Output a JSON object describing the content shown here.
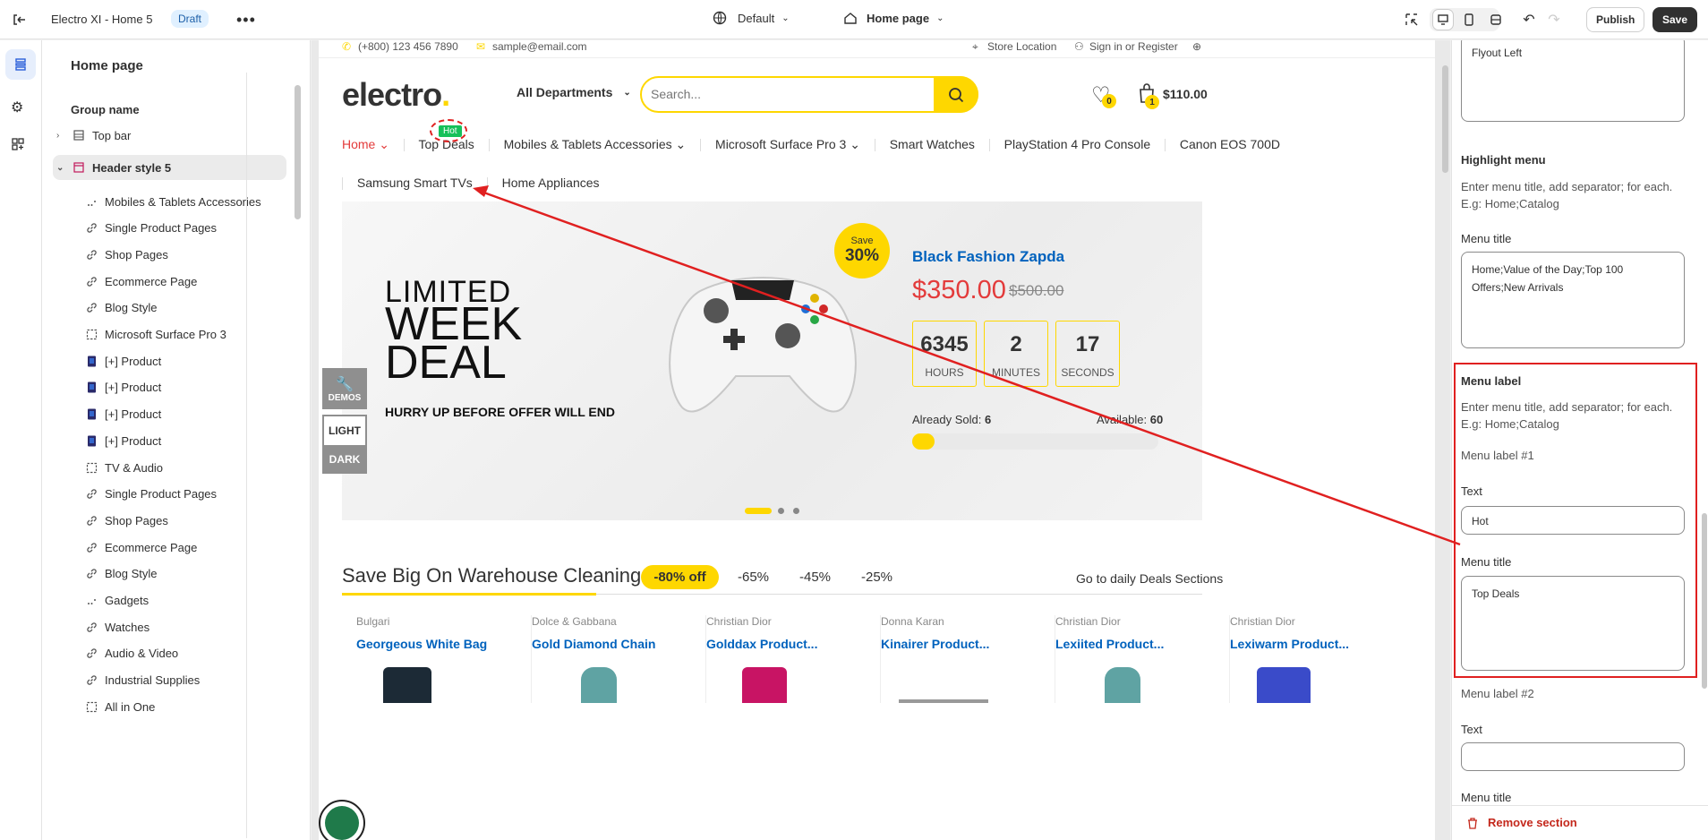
{
  "topbar": {
    "title": "Electro XI - Home 5",
    "draft_badge": "Draft",
    "theme_select": "Default",
    "page_select": "Home page",
    "publish_label": "Publish",
    "save_label": "Save"
  },
  "sidebar": {
    "title": "Home page",
    "group_name": "Group name",
    "top_bar": "Top bar",
    "header_style": "Header style 5",
    "items": [
      {
        "label": "Mobiles & Tablets Accessories",
        "icon": "dots-icon"
      },
      {
        "label": "Single Product Pages",
        "icon": "link-icon"
      },
      {
        "label": "Shop Pages",
        "icon": "link-icon"
      },
      {
        "label": "Ecommerce Page",
        "icon": "link-icon"
      },
      {
        "label": "Blog Style",
        "icon": "link-icon"
      },
      {
        "label": "Microsoft Surface Pro 3",
        "icon": "dashed-square-icon"
      },
      {
        "label": "[+] Product",
        "icon": "product-thumb-icon"
      },
      {
        "label": "[+] Product",
        "icon": "product-thumb-icon"
      },
      {
        "label": "[+] Product",
        "icon": "product-thumb-icon"
      },
      {
        "label": "[+] Product",
        "icon": "product-thumb-icon"
      },
      {
        "label": "TV & Audio",
        "icon": "dashed-square-icon"
      },
      {
        "label": "Single Product Pages",
        "icon": "link-icon"
      },
      {
        "label": "Shop Pages",
        "icon": "link-icon"
      },
      {
        "label": "Ecommerce Page",
        "icon": "link-icon"
      },
      {
        "label": "Blog Style",
        "icon": "link-icon"
      },
      {
        "label": "Gadgets",
        "icon": "dots-icon"
      },
      {
        "label": "Watches",
        "icon": "link-icon"
      },
      {
        "label": "Audio & Video",
        "icon": "link-icon"
      },
      {
        "label": "Industrial Supplies",
        "icon": "link-icon"
      },
      {
        "label": "All in One",
        "icon": "dashed-square-icon"
      }
    ]
  },
  "store": {
    "phone": "(+800) 123 456 7890",
    "email": "sample@email.com",
    "store_location": "Store Location",
    "sign_in": "Sign in or Register",
    "logo": "electro",
    "logo_dot": ".",
    "departments": "All Departments",
    "search_placeholder": "Search...",
    "wishlist_count": "0",
    "cart_count": "1",
    "cart_total": "$110.00",
    "nav": [
      "Home",
      "Top Deals",
      "Mobiles & Tablets Accessories",
      "Microsoft Surface Pro 3",
      "Smart Watches",
      "PlayStation 4 Pro Console",
      "Canon EOS 700D",
      "Samsung Smart TVs",
      "Home Appliances"
    ],
    "hot_badge": "Hot",
    "banner": {
      "line1": "LIMITED",
      "line2": "WEEK",
      "line3": "DEAL",
      "hurry": "HURRY UP BEFORE OFFER WILL END",
      "save_label": "Save",
      "save_pct": "30%",
      "product_name": "Black Fashion Zapda",
      "price": "$350.00",
      "old_price": "$500.00",
      "hours": "6345",
      "hours_label": "HOURS",
      "minutes": "2",
      "minutes_label": "MINUTES",
      "seconds": "17",
      "seconds_label": "SECONDS",
      "sold_label": "Already Sold:",
      "sold_value": "6",
      "avail_label": "Available:",
      "avail_value": "60",
      "sold_fraction": 0.09
    },
    "demos": "DEMOS",
    "light": "LIGHT",
    "dark": "DARK",
    "deals": {
      "title": "Save Big On Warehouse Cleaning",
      "tabs": [
        "-80% off",
        "-65%",
        "-45%",
        "-25%"
      ],
      "link": "Go to daily Deals Sections"
    },
    "products": [
      {
        "brand": "Bulgari",
        "name": "Georgeous White Bag"
      },
      {
        "brand": "Dolce & Gabbana",
        "name": "Gold Diamond Chain"
      },
      {
        "brand": "Christian Dior",
        "name": "Golddax Product..."
      },
      {
        "brand": "Donna Karan",
        "name": "Kinairer Product..."
      },
      {
        "brand": "Christian Dior",
        "name": "Lexiited Product..."
      },
      {
        "brand": "Christian Dior",
        "name": "Lexiwarm Product..."
      }
    ]
  },
  "right_panel": {
    "top_textarea": "Flyout Left",
    "highlight_title": "Highlight menu",
    "highlight_help": "Enter menu title, add separator; for each. E.g: Home;Catalog",
    "menu_title_label": "Menu title",
    "menu_title_value": "Home;Value of the Day;Top 100 Offers;New Arrivals",
    "menu_label_title": "Menu label",
    "menu_label_help": "Enter menu title, add separator; for each. E.g: Home;Catalog",
    "label1": "Menu label #1",
    "text_label": "Text",
    "text1_value": "Hot",
    "menu_title_label2": "Menu title",
    "menu_title2_value": "Top Deals",
    "label2": "Menu label #2",
    "text_label2": "Text",
    "text2_value": "",
    "menu_title_label3": "Menu title",
    "remove_section": "Remove section"
  },
  "colors": {
    "accent_yellow": "#fed700",
    "annotation_red": "#e02020",
    "link_blue": "#0062bd",
    "price_red": "#e33b3b",
    "hot_green": "#16c05a"
  }
}
